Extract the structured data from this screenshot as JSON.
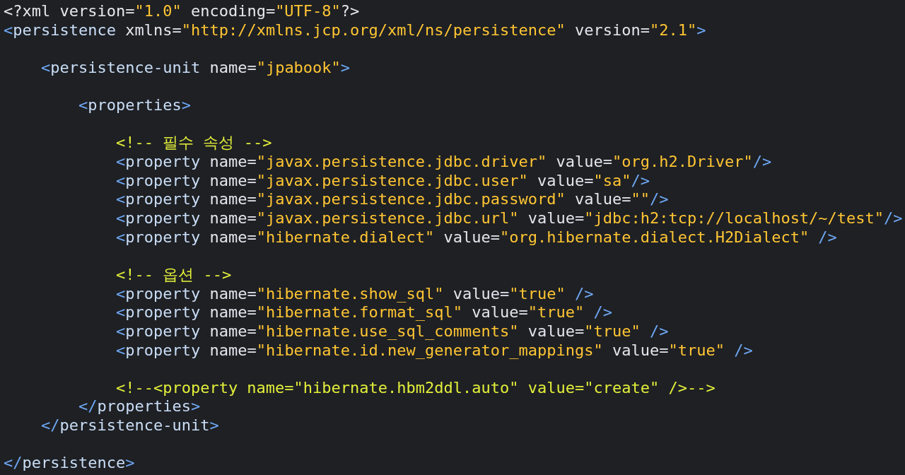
{
  "editor": {
    "lines": [
      {
        "kind": "code",
        "tokens": [
          {
            "kind": "text",
            "text": "<?xml version="
          },
          {
            "kind": "value",
            "text": "\"1.0\""
          },
          {
            "kind": "text",
            "text": " encoding="
          },
          {
            "kind": "value",
            "text": "\"UTF-8\""
          },
          {
            "kind": "text",
            "text": "?>"
          }
        ]
      },
      {
        "kind": "code",
        "tokens": [
          {
            "kind": "punct",
            "text": "<"
          },
          {
            "kind": "tag",
            "text": "persistence"
          },
          {
            "kind": "attr",
            "text": " xmlns="
          },
          {
            "kind": "value",
            "text": "\"http://xmlns.jcp.org/xml/ns/persistence\""
          },
          {
            "kind": "attr",
            "text": " version="
          },
          {
            "kind": "value",
            "text": "\"2.1\""
          },
          {
            "kind": "punct",
            "text": ">"
          }
        ]
      },
      {
        "kind": "blank"
      },
      {
        "kind": "code",
        "tokens": [
          {
            "kind": "punct",
            "text": "    <"
          },
          {
            "kind": "tag",
            "text": "persistence-unit"
          },
          {
            "kind": "attr",
            "text": " name="
          },
          {
            "kind": "value",
            "text": "\"jpabook\""
          },
          {
            "kind": "punct",
            "text": ">"
          }
        ]
      },
      {
        "kind": "blank"
      },
      {
        "kind": "code",
        "tokens": [
          {
            "kind": "punct",
            "text": "        <"
          },
          {
            "kind": "tag",
            "text": "properties"
          },
          {
            "kind": "punct",
            "text": ">"
          }
        ]
      },
      {
        "kind": "blank"
      },
      {
        "kind": "code",
        "tokens": [
          {
            "kind": "comment",
            "text": "            <!-- 필수 속성 -->"
          }
        ]
      },
      {
        "kind": "code",
        "tokens": [
          {
            "kind": "punct",
            "text": "            <"
          },
          {
            "kind": "tag",
            "text": "property"
          },
          {
            "kind": "attr",
            "text": " name="
          },
          {
            "kind": "value",
            "text": "\"javax.persistence.jdbc.driver\""
          },
          {
            "kind": "attr",
            "text": " value="
          },
          {
            "kind": "value",
            "text": "\"org.h2.Driver\""
          },
          {
            "kind": "punct",
            "text": "/>"
          }
        ]
      },
      {
        "kind": "code",
        "tokens": [
          {
            "kind": "punct",
            "text": "            <"
          },
          {
            "kind": "tag",
            "text": "property"
          },
          {
            "kind": "attr",
            "text": " name="
          },
          {
            "kind": "value",
            "text": "\"javax.persistence.jdbc.user\""
          },
          {
            "kind": "attr",
            "text": " value="
          },
          {
            "kind": "value",
            "text": "\"sa\""
          },
          {
            "kind": "punct",
            "text": "/>"
          }
        ]
      },
      {
        "kind": "code",
        "tokens": [
          {
            "kind": "punct",
            "text": "            <"
          },
          {
            "kind": "tag",
            "text": "property"
          },
          {
            "kind": "attr",
            "text": " name="
          },
          {
            "kind": "value",
            "text": "\"javax.persistence.jdbc.password\""
          },
          {
            "kind": "attr",
            "text": " value="
          },
          {
            "kind": "value",
            "text": "\"\""
          },
          {
            "kind": "punct",
            "text": "/>"
          }
        ]
      },
      {
        "kind": "code",
        "tokens": [
          {
            "kind": "punct",
            "text": "            <"
          },
          {
            "kind": "tag",
            "text": "property"
          },
          {
            "kind": "attr",
            "text": " name="
          },
          {
            "kind": "value",
            "text": "\"javax.persistence.jdbc.url\""
          },
          {
            "kind": "attr",
            "text": " value="
          },
          {
            "kind": "value",
            "text": "\"jdbc:h2:tcp://localhost/~/test\""
          },
          {
            "kind": "punct",
            "text": "/>"
          }
        ]
      },
      {
        "kind": "code",
        "tokens": [
          {
            "kind": "punct",
            "text": "            <"
          },
          {
            "kind": "tag",
            "text": "property"
          },
          {
            "kind": "attr",
            "text": " name="
          },
          {
            "kind": "value",
            "text": "\"hibernate.dialect\""
          },
          {
            "kind": "attr",
            "text": " value="
          },
          {
            "kind": "value",
            "text": "\"org.hibernate.dialect.H2Dialect\""
          },
          {
            "kind": "punct",
            "text": " />"
          }
        ]
      },
      {
        "kind": "blank"
      },
      {
        "kind": "code",
        "tokens": [
          {
            "kind": "comment",
            "text": "            <!-- 옵션 -->"
          }
        ]
      },
      {
        "kind": "code",
        "tokens": [
          {
            "kind": "punct",
            "text": "            <"
          },
          {
            "kind": "tag",
            "text": "property"
          },
          {
            "kind": "attr",
            "text": " name="
          },
          {
            "kind": "value",
            "text": "\"hibernate.show_sql\""
          },
          {
            "kind": "attr",
            "text": " value="
          },
          {
            "kind": "value",
            "text": "\"true\""
          },
          {
            "kind": "punct",
            "text": " />"
          }
        ]
      },
      {
        "kind": "code",
        "tokens": [
          {
            "kind": "punct",
            "text": "            <"
          },
          {
            "kind": "tag",
            "text": "property"
          },
          {
            "kind": "attr",
            "text": " name="
          },
          {
            "kind": "value",
            "text": "\"hibernate.format_sql\""
          },
          {
            "kind": "attr",
            "text": " value="
          },
          {
            "kind": "value",
            "text": "\"true\""
          },
          {
            "kind": "punct",
            "text": " />"
          }
        ]
      },
      {
        "kind": "code",
        "tokens": [
          {
            "kind": "punct",
            "text": "            <"
          },
          {
            "kind": "tag",
            "text": "property"
          },
          {
            "kind": "attr",
            "text": " name="
          },
          {
            "kind": "value",
            "text": "\"hibernate.use_sql_comments\""
          },
          {
            "kind": "attr",
            "text": " value="
          },
          {
            "kind": "value",
            "text": "\"true\""
          },
          {
            "kind": "punct",
            "text": " />"
          }
        ]
      },
      {
        "kind": "code",
        "tokens": [
          {
            "kind": "punct",
            "text": "            <"
          },
          {
            "kind": "tag",
            "text": "property"
          },
          {
            "kind": "attr",
            "text": " name="
          },
          {
            "kind": "value",
            "text": "\"hibernate.id.new_generator_mappings\""
          },
          {
            "kind": "attr",
            "text": " value="
          },
          {
            "kind": "value",
            "text": "\"true\""
          },
          {
            "kind": "punct",
            "text": " />"
          }
        ]
      },
      {
        "kind": "blank"
      },
      {
        "kind": "code",
        "tokens": [
          {
            "kind": "comment",
            "text": "            <!--<property name=\"hibernate.hbm2ddl.auto\" value=\"create\" />-->"
          }
        ]
      },
      {
        "kind": "code",
        "tokens": [
          {
            "kind": "punct",
            "text": "        </"
          },
          {
            "kind": "tag",
            "text": "properties"
          },
          {
            "kind": "punct",
            "text": ">"
          }
        ]
      },
      {
        "kind": "code",
        "tokens": [
          {
            "kind": "punct",
            "text": "    </"
          },
          {
            "kind": "tag",
            "text": "persistence-unit"
          },
          {
            "kind": "punct",
            "text": ">"
          }
        ]
      },
      {
        "kind": "blank"
      },
      {
        "kind": "code",
        "tokens": [
          {
            "kind": "punct",
            "text": "</"
          },
          {
            "kind": "tag",
            "text": "persistence"
          },
          {
            "kind": "punct",
            "text": ">"
          }
        ]
      }
    ]
  }
}
